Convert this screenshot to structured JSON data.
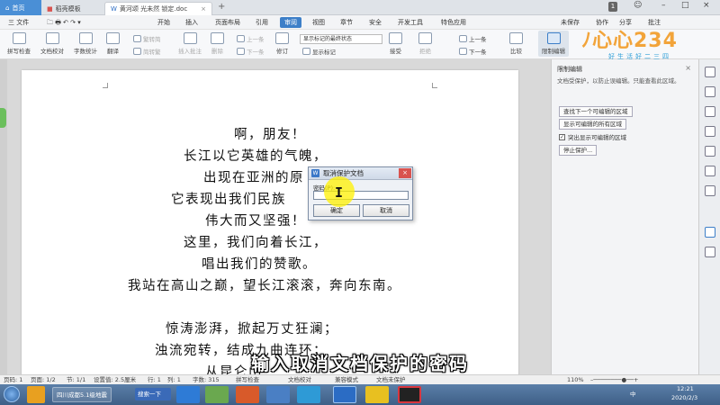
{
  "tabs": {
    "home": "首页",
    "template": "稻壳模板",
    "document": "黄河颂 光未然 锁定.doc",
    "new_tab": "+",
    "window_count": "1"
  },
  "menu": {
    "file": "三 文件",
    "items": [
      "开始",
      "插入",
      "页面布局",
      "引用",
      "审阅",
      "视图",
      "章节",
      "安全",
      "开发工具",
      "特色应用"
    ],
    "active": "审阅",
    "sync": "未保存",
    "collab": "协作",
    "share": "分享",
    "comment": "批注"
  },
  "ribbon": {
    "spell_check": "拼写检查",
    "doc_proof": "文档校对",
    "word_count": "字数统计",
    "translate": "翻译",
    "trad_simp": "繁转简",
    "simp_trad": "简转繁",
    "insert_comment": "插入批注",
    "delete": "删除",
    "prev": "上一条",
    "next": "下一条",
    "revise": "修订",
    "show_markup_state": "显示标记的最终状态",
    "show_markup": "显示标记",
    "accept": "接受",
    "reject": "拒绝",
    "prev2": "上一条",
    "next2": "下一条",
    "compare": "比较",
    "restrict_edit": "限制编辑"
  },
  "logo": {
    "main": "ﾉ心心234",
    "sub": "好生活好二三四"
  },
  "document": {
    "lines": [
      "啊，朋友！",
      "长江以它英雄的气魄，",
      "出现在亚洲的原",
      "它表现出我们民族",
      "伟大而又坚强！",
      "这里，我们向着长江，",
      "唱出我们的赞歌。",
      "我站在高山之巅，望长江滚滚，奔向东南。",
      "",
      "惊涛澎湃，掀起万丈狂澜；",
      "浊流宛转，结成九曲连环；",
      "从昆仑山"
    ]
  },
  "panel": {
    "title": "限制编辑",
    "desc": "文档受保护，以防止误编辑。只能查看此区域。",
    "find_next": "查找下一个可编辑的区域",
    "show_all": "显示可编辑的所有区域",
    "highlight": "突出显示可编辑的区域",
    "highlight_checked": "✓",
    "stop": "停止保护..."
  },
  "dialog": {
    "title": "取消保护文档",
    "label": "密码(P):",
    "ok": "确定",
    "cancel": "取消",
    "close": "×"
  },
  "subtitle": "输入取消文档保护的密码",
  "status": {
    "page_num": "页码: 1",
    "pages": "页面: 1/2",
    "section": "节: 1/1",
    "setting": "设置值: 2.5厘米",
    "row": "行: 1",
    "col": "列: 1",
    "words": "字数: 315",
    "spell": "拼写检查",
    "proof": "文档校对",
    "mode": "兼容模式",
    "protect": "文档未保护",
    "zoom": "110%"
  },
  "taskbar": {
    "task": "四川成都5.1级地震",
    "search": "搜索一下",
    "ime": "中",
    "time": "12:21",
    "date": "2020/2/3"
  },
  "colors": {
    "accent": "#3d7fc8",
    "highlight": "#fff000",
    "logo_orange": "#f2a43a",
    "logo_blue": "#2f9fd8"
  }
}
